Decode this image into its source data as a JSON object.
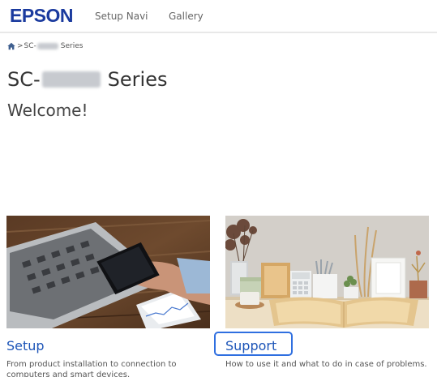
{
  "header": {
    "logo": "EPSON",
    "nav": [
      {
        "label": "Setup Navi"
      },
      {
        "label": "Gallery"
      }
    ]
  },
  "breadcrumb": {
    "separator": ">",
    "prefix": "SC-",
    "suffix": "Series"
  },
  "page": {
    "title_prefix": "SC-",
    "title_suffix": "Series",
    "welcome": "Welcome!"
  },
  "cards": [
    {
      "title": "Setup",
      "description": "From product installation to connection to computers and smart devices."
    },
    {
      "title": "Support",
      "description": "How to use it and what to do in case of problems."
    }
  ],
  "colors": {
    "logo": "#1a3a9e",
    "link": "#1d55b8",
    "focus_ring": "#2f6fe0"
  },
  "icons": {
    "home": "home-icon"
  }
}
